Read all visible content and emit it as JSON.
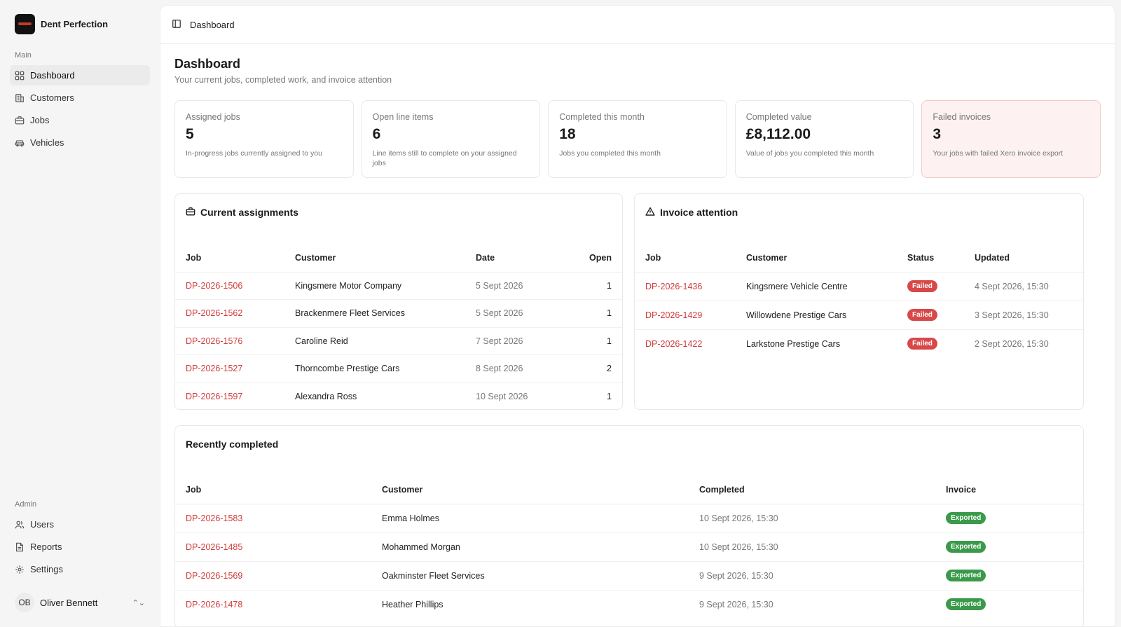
{
  "brand": {
    "name": "Dent Perfection"
  },
  "sidebar": {
    "main_label": "Main",
    "main_items": [
      {
        "label": "Dashboard",
        "icon": "grid-icon"
      },
      {
        "label": "Customers",
        "icon": "building-icon"
      },
      {
        "label": "Jobs",
        "icon": "briefcase-icon"
      },
      {
        "label": "Vehicles",
        "icon": "car-icon"
      }
    ],
    "admin_label": "Admin",
    "admin_items": [
      {
        "label": "Users",
        "icon": "users-icon"
      },
      {
        "label": "Reports",
        "icon": "file-icon"
      },
      {
        "label": "Settings",
        "icon": "gear-icon"
      }
    ],
    "user": {
      "initials": "OB",
      "name": "Oliver Bennett"
    }
  },
  "topbar": {
    "breadcrumb": "Dashboard"
  },
  "page": {
    "title": "Dashboard",
    "subtitle": "Your current jobs, completed work, and invoice attention"
  },
  "stats": [
    {
      "label": "Assigned jobs",
      "value": "5",
      "desc": "In-progress jobs currently assigned to you"
    },
    {
      "label": "Open line items",
      "value": "6",
      "desc": "Line items still to complete on your assigned jobs"
    },
    {
      "label": "Completed this month",
      "value": "18",
      "desc": "Jobs you completed this month"
    },
    {
      "label": "Completed value",
      "value": "£8,112.00",
      "desc": "Value of jobs you completed this month"
    },
    {
      "label": "Failed invoices",
      "value": "3",
      "desc": "Your jobs with failed Xero invoice export"
    }
  ],
  "assignments": {
    "title": "Current assignments",
    "headers": [
      "Job",
      "Customer",
      "Date",
      "Open"
    ],
    "rows": [
      {
        "job": "DP-2026-1506",
        "customer": "Kingsmere Motor Company",
        "date": "5 Sept 2026",
        "open": "1"
      },
      {
        "job": "DP-2026-1562",
        "customer": "Brackenmere Fleet Services",
        "date": "5 Sept 2026",
        "open": "1"
      },
      {
        "job": "DP-2026-1576",
        "customer": "Caroline Reid",
        "date": "7 Sept 2026",
        "open": "1"
      },
      {
        "job": "DP-2026-1527",
        "customer": "Thorncombe Prestige Cars",
        "date": "8 Sept 2026",
        "open": "2"
      },
      {
        "job": "DP-2026-1597",
        "customer": "Alexandra Ross",
        "date": "10 Sept 2026",
        "open": "1"
      }
    ]
  },
  "invoice_attention": {
    "title": "Invoice attention",
    "headers": [
      "Job",
      "Customer",
      "Status",
      "Updated"
    ],
    "rows": [
      {
        "job": "DP-2026-1436",
        "customer": "Kingsmere Vehicle Centre",
        "status": "Failed",
        "updated": "4 Sept 2026, 15:30"
      },
      {
        "job": "DP-2026-1429",
        "customer": "Willowdene Prestige Cars",
        "status": "Failed",
        "updated": "3 Sept 2026, 15:30"
      },
      {
        "job": "DP-2026-1422",
        "customer": "Larkstone Prestige Cars",
        "status": "Failed",
        "updated": "2 Sept 2026, 15:30"
      }
    ]
  },
  "recently_completed": {
    "title": "Recently completed",
    "headers": [
      "Job",
      "Customer",
      "Completed",
      "Invoice"
    ],
    "rows": [
      {
        "job": "DP-2026-1583",
        "customer": "Emma Holmes",
        "completed": "10 Sept 2026, 15:30",
        "invoice": "Exported"
      },
      {
        "job": "DP-2026-1485",
        "customer": "Mohammed Morgan",
        "completed": "10 Sept 2026, 15:30",
        "invoice": "Exported"
      },
      {
        "job": "DP-2026-1569",
        "customer": "Oakminster Fleet Services",
        "completed": "9 Sept 2026, 15:30",
        "invoice": "Exported"
      },
      {
        "job": "DP-2026-1478",
        "customer": "Heather Phillips",
        "completed": "9 Sept 2026, 15:30",
        "invoice": "Exported"
      }
    ]
  },
  "colors": {
    "accent": "#d23b3b",
    "failed": "#d94848",
    "exported": "#3a9a4a"
  }
}
